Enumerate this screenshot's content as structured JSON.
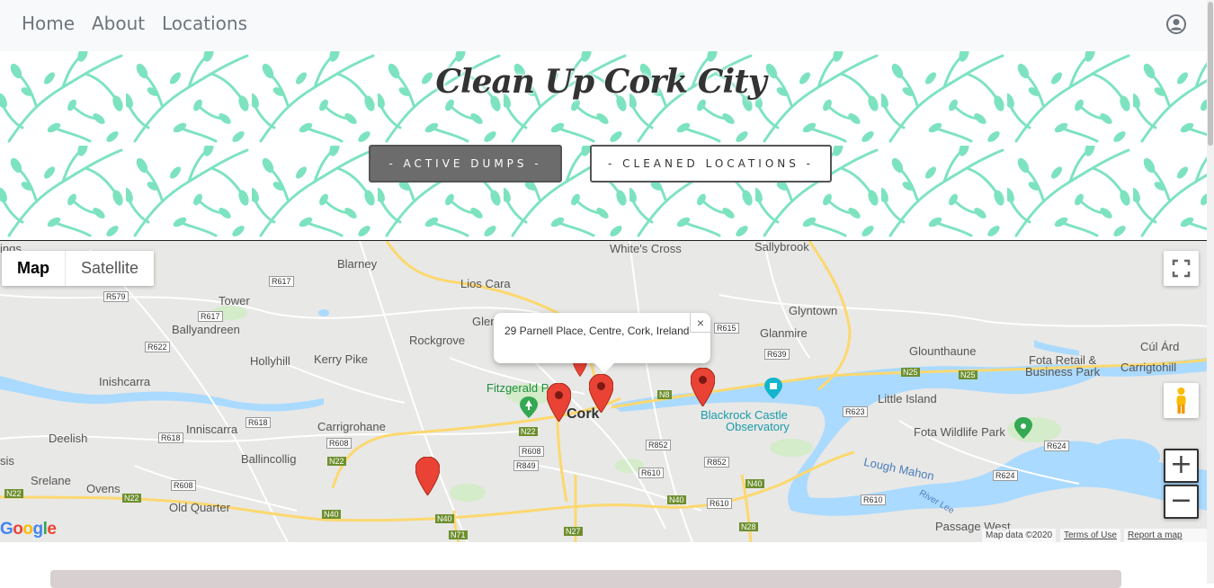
{
  "nav": {
    "links": [
      "Home",
      "About",
      "Locations"
    ],
    "user_icon": "user-circle-icon"
  },
  "hero": {
    "title": "Clean Up Cork City",
    "buttons": {
      "active": "- ACTIVE DUMPS -",
      "cleaned": "- CLEANED LOCATIONS -"
    },
    "pattern_color": "#7de3bf"
  },
  "map": {
    "map_type": {
      "map": "Map",
      "satellite": "Satellite"
    },
    "zoom": {
      "in": "+",
      "out": "−"
    },
    "infowindow": {
      "text": "29 Parnell Place, Centre, Cork, Ireland",
      "close": "×"
    },
    "places": {
      "whites_cross": "White's Cross",
      "sallybrook": "Sallybrook",
      "blarney": "Blarney",
      "lios_cara": "Lios Cara",
      "tower": "Tower",
      "glen": "Glen",
      "glyntown": "Glyntown",
      "ballyandreen": "Ballyandreen",
      "rockgrove": "Rockgrove",
      "glanmire": "Glanmire",
      "glounthaune": "Glounthaune",
      "cul_ard": "Cúl Árd",
      "fota_retail": "Fota Retail &",
      "business_park": "Business Park",
      "carrigtohill": "Carrigtohill",
      "hollyhill": "Hollyhill",
      "kerry_pike": "Kerry Pike",
      "inishcarra": "Inishcarra",
      "fitzgerald": "Fitzgerald Park",
      "cork": "Cork",
      "blackrock1": "Blackrock Castle",
      "blackrock2": "Observatory",
      "little_island": "Little Island",
      "inniscarra": "Inniscarra",
      "carrigrohane": "Carrigrohane",
      "fota_wildlife": "Fota Wildlife Park",
      "deelish": "Deelish",
      "ballincollig": "Ballincollig",
      "lough_mahon": "Lough Mahon",
      "river_lee": "River Lee",
      "srelane": "Srelane",
      "ovens": "Ovens",
      "sis": "sis",
      "ings": "ings",
      "old_quarter": "Old Quarter",
      "passage_west": "Passage West"
    },
    "roads": {
      "r617": "R617",
      "r579": "R579",
      "r622": "R622",
      "r615": "R615",
      "r639": "R639",
      "r618a": "R618",
      "r618b": "R618",
      "r608a": "R608",
      "r608b": "R608",
      "r608c": "R608",
      "r849": "R849",
      "r852a": "R852",
      "r852b": "R852",
      "r610a": "R610",
      "r610b": "R610",
      "r610c": "R610",
      "r623": "R623",
      "r624a": "R624",
      "r624b": "R624",
      "n25a": "N25",
      "n25b": "N25",
      "n8": "N8",
      "n22a": "N22",
      "n22b": "N22",
      "n22c": "N22",
      "n22d": "N22",
      "n40a": "N40",
      "n40b": "N40",
      "n40c": "N40",
      "n40d": "N40",
      "n71": "N71",
      "n27": "N27",
      "n28": "N28"
    },
    "footer": {
      "logo": "Google",
      "map_data": "Map data ©2020",
      "terms": "Terms of Use",
      "report": "Report a map error"
    },
    "icons": {
      "fullscreen": "fullscreen-icon",
      "pegman": "pegman-icon",
      "marker": "map-marker-icon"
    },
    "colors": {
      "water": "#aadaff",
      "marker": "#ea4335",
      "motorway": "#fcd86f",
      "land": "#e8e8e6"
    }
  }
}
